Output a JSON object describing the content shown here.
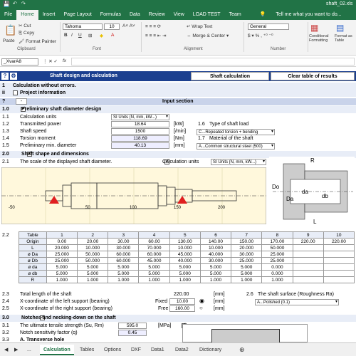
{
  "title": {
    "filename": "shaft_02.xls"
  },
  "menu": [
    "File",
    "Home",
    "Insert",
    "Page Layout",
    "Formulas",
    "Data",
    "Review",
    "View",
    "LOAD TEST",
    "Team"
  ],
  "tell_me": "Tell me what you want to do...",
  "ribbon": {
    "cut": "Cut",
    "copy": "Copy",
    "format_painter": "Format Painter",
    "paste": "Paste",
    "clipboard": "Clipboard",
    "font_name": "Tahoma",
    "font_size": "10",
    "font": "Font",
    "wrap": "Wrap Text",
    "merge": "Merge & Center",
    "alignment": "Alignment",
    "number": "Number",
    "general": "General",
    "cond_fmt": "Conditional Formatting",
    "fmt_table": "Format as Table"
  },
  "namebox": "_XvarA8",
  "fx": "fx",
  "header": {
    "title": "Shaft design and calculation",
    "btn_calc": "Shaft calculation",
    "btn_clear": "Clear table of results"
  },
  "rows": {
    "r1": "Calculation without errors.",
    "r2": "Project information",
    "r3": "Input section",
    "s1": "Preliminary shaft diameter design",
    "l11": "Calculation units",
    "v11": "SI Units (N, mm, kW...)",
    "l12": "Transmitted power",
    "v12": "18.64",
    "u12": "[kW]",
    "l13": "Shaft speed",
    "v13": "1500",
    "u13": "[/min]",
    "l14": "Torsion moment",
    "v14": "118.69",
    "u14": "[Nm]",
    "l15": "Preliminary min. diameter",
    "v15": "40.13",
    "u15": "[mm]",
    "l16": "Type of shaft load",
    "v16": "C...Repeated torsion + bending",
    "l17": "Material of the shaft",
    "v17": "A...Common structural steel (500)",
    "s2": "Shaft shape and dimensions",
    "l21": "The scale of the displayed shaft diameter.",
    "l21b": "Calculation units",
    "v21": "SI Units (N, mm, kW...)",
    "n11": "1.1",
    "n12": "1.2",
    "n13": "1.3",
    "n14": "1.4",
    "n15": "1.5",
    "n16": "1.6",
    "n17": "1.7",
    "n20": "2.0",
    "n21": "2.1",
    "n22": "2.2",
    "n23": "2.3",
    "n24": "2.4",
    "n25": "2.5",
    "n26": "2.6",
    "n30": "3.0",
    "n31": "3.1",
    "n32": "3.2",
    "n33": "3.3",
    "n10": "1.0",
    "l23": "Total length of the shaft",
    "v23": "220.00",
    "u23": "[mm]",
    "l24": "X-coordinate of the left support (bearing)",
    "t24": "Fixed",
    "v24": "10.00",
    "u24": "[mm]",
    "l25": "X-coordinate of the right support (bearing)",
    "t25": "Free",
    "v25": "160.00",
    "u25": "[mm]",
    "l26": "The shaft surface (Roughness Ra)",
    "v26": "A...Polished (0.1)",
    "s3": "Notches and necking-down on the shaft",
    "l31": "The ultimate tensile strength (Su, Rm)",
    "v31": "595.0",
    "u31": "[MPa]",
    "l32": "Notch sensitivity factor (q)",
    "v32": "0.45",
    "l33": "A. Transverse hole"
  },
  "chart": {
    "ticks": [
      "-50",
      "50",
      "100",
      "150",
      "200"
    ]
  },
  "diagram": {
    "R": "R",
    "Do": "Do",
    "Da": "Da",
    "da": "da",
    "db": "db",
    "L": "L"
  },
  "table": {
    "head": [
      "Table",
      "1",
      "2",
      "3",
      "4",
      "5",
      "6",
      "7",
      "8",
      "9",
      "10"
    ],
    "rows": [
      [
        "Origin",
        "0.00",
        "20.00",
        "30.00",
        "60.00",
        "130.00",
        "140.00",
        "150.00",
        "170.00",
        "220.00",
        "220.00"
      ],
      [
        "L",
        "20.000",
        "10.000",
        "30.000",
        "70.000",
        "10.000",
        "10.000",
        "20.000",
        "50.000",
        "",
        ""
      ],
      [
        "ø Da",
        "25.000",
        "50.000",
        "60.000",
        "60.000",
        "45.000",
        "40.000",
        "30.000",
        "25.000",
        "",
        ""
      ],
      [
        "ø Db",
        "25.000",
        "50.000",
        "60.000",
        "45.000",
        "40.000",
        "30.000",
        "25.000",
        "25.000",
        "",
        ""
      ],
      [
        "ø da",
        "5.000",
        "5.000",
        "5.000",
        "5.000",
        "5.000",
        "5.000",
        "5.000",
        "0.000",
        "",
        ""
      ],
      [
        "ø db",
        "5.000",
        "5.000",
        "5.000",
        "5.000",
        "5.000",
        "5.000",
        "5.000",
        "0.000",
        "",
        ""
      ],
      [
        "R",
        "1.000",
        "1.000",
        "1.000",
        "1.000",
        "1.000",
        "1.000",
        "1.000",
        "1.000",
        "",
        ""
      ]
    ]
  },
  "tabs": [
    "Calculation",
    "Tables",
    "Options",
    "DXF",
    "Data1",
    "Data2",
    "Dictionary"
  ],
  "colors": {
    "excel_green": "#217346",
    "header_blue": "#1b3f8f",
    "load_red": "#e02020"
  }
}
